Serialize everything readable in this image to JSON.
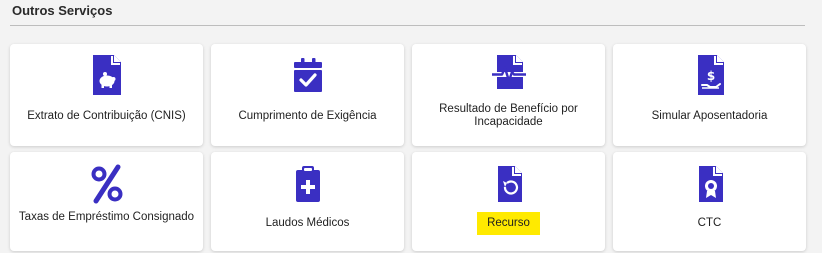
{
  "section": {
    "title": "Outros Serviços"
  },
  "colors": {
    "icon": "#3a2fc2",
    "highlight": "#ffea00",
    "card": "#ffffff"
  },
  "cards": [
    {
      "label": "Extrato de Contribuição (CNIS)",
      "icon": "piggy-bank-document-icon"
    },
    {
      "label": "Cumprimento de Exigência",
      "icon": "calendar-check-icon"
    },
    {
      "label": "Resultado de Benefício por Incapacidade",
      "icon": "pulse-document-icon"
    },
    {
      "label": "Simular Aposentadoria",
      "icon": "money-hand-document-icon"
    },
    {
      "label": "Taxas de Empréstimo Consignado",
      "icon": "percent-icon"
    },
    {
      "label": "Laudos Médicos",
      "icon": "medical-clipboard-icon"
    },
    {
      "label": "Recurso",
      "icon": "undo-document-icon"
    },
    {
      "label": "CTC",
      "icon": "certificate-document-icon"
    }
  ]
}
